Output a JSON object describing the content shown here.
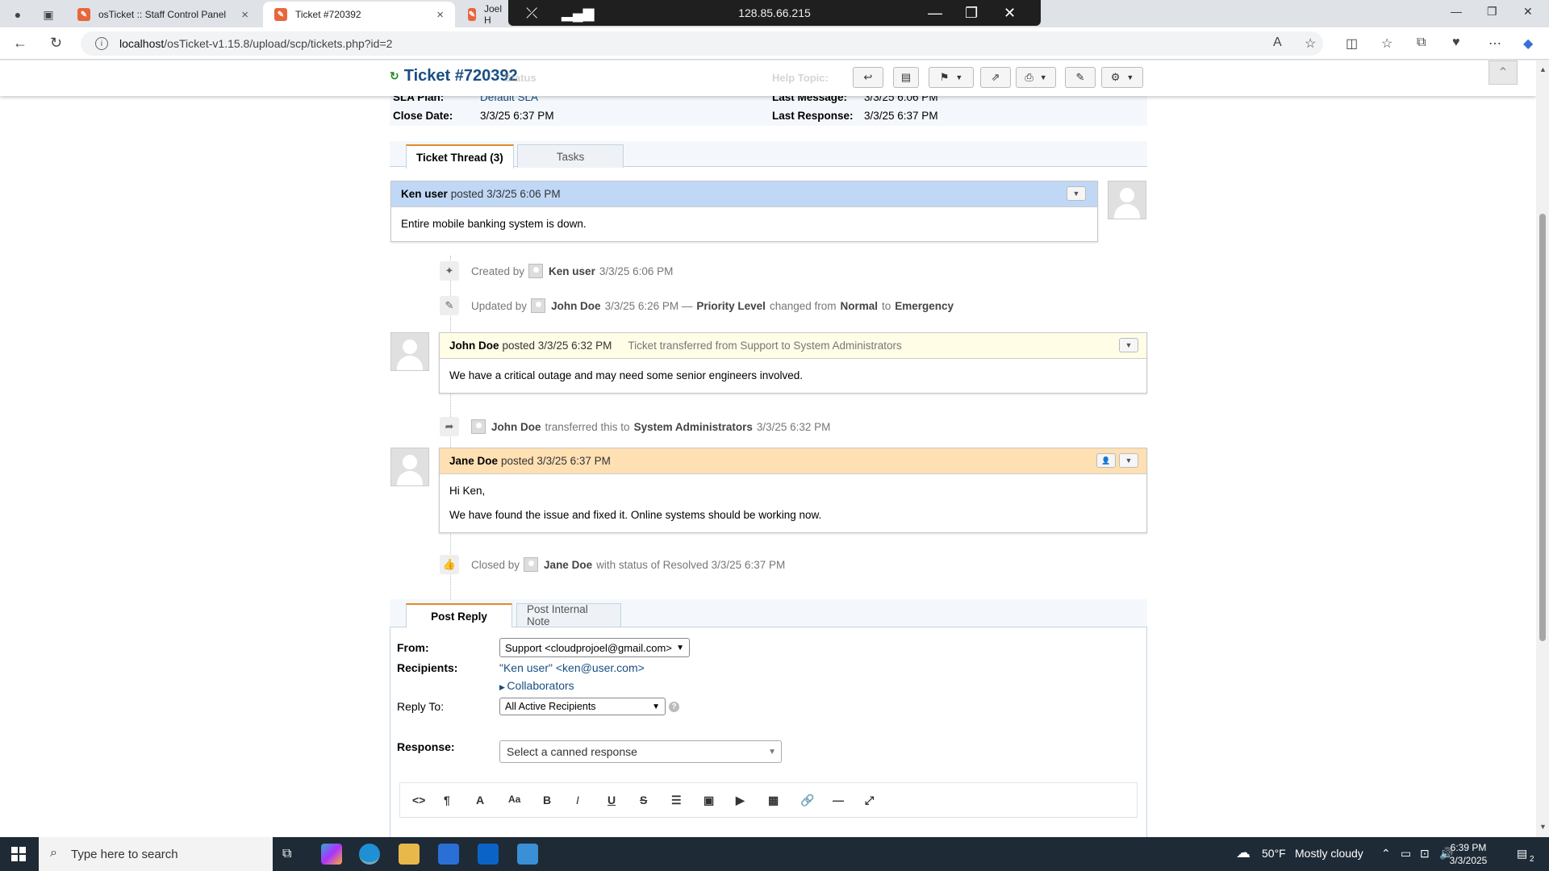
{
  "browser": {
    "tabs": [
      {
        "label": "osTicket :: Staff Control Panel",
        "active": false
      },
      {
        "label": "Ticket #720392",
        "active": true
      },
      {
        "label": "Joel H",
        "active": false
      }
    ],
    "remote_ip": "128.85.66.215",
    "url_host": "localhost",
    "url_path": "/osTicket-v1.15.8/upload/scp/tickets.php?id=2"
  },
  "ticket": {
    "title": "Ticket #720392",
    "ghost_left": "Status",
    "ghost_help": "Help Topic:",
    "info": {
      "sla_label": "SLA Plan:",
      "sla_value": "Default SLA",
      "last_message_label": "Last Message:",
      "last_message_value": "3/3/25 6:06 PM",
      "close_date_label": "Close Date:",
      "close_date_value": "3/3/25 6:37 PM",
      "last_response_label": "Last Response:",
      "last_response_value": "3/3/25 6:37 PM"
    }
  },
  "thread_tabs": {
    "thread": "Ticket Thread (3)",
    "tasks": "Tasks"
  },
  "thread": {
    "entry1": {
      "author": "Ken user",
      "posted": "posted 3/3/25 6:06 PM",
      "body": "Entire mobile banking system is down."
    },
    "event_created": {
      "pre": "Created by",
      "who": "Ken user",
      "when": "3/3/25 6:06 PM"
    },
    "event_updated": {
      "pre": "Updated by",
      "who": "John Doe",
      "when": "3/3/25 6:26 PM —",
      "field": "Priority Level",
      "mid": "changed from",
      "from": "Normal",
      "to_word": "to",
      "to": "Emergency"
    },
    "entry2": {
      "author": "John Doe",
      "posted": "posted 3/3/25 6:32 PM",
      "title": "Ticket transferred from Support to System Administrators",
      "body": "We have a critical outage and may need some senior engineers involved."
    },
    "event_transfer": {
      "who": "John Doe",
      "mid": "transferred this to",
      "dept": "System Administrators",
      "when": "3/3/25 6:32 PM"
    },
    "entry3": {
      "author": "Jane Doe",
      "posted": "posted 3/3/25 6:37 PM",
      "body1": "Hi Ken,",
      "body2": "We have found the issue and fixed it. Online systems should be working now."
    },
    "event_closed": {
      "pre": "Closed by",
      "who": "Jane Doe",
      "post": "with status of Resolved 3/3/25 6:37 PM"
    }
  },
  "reply": {
    "tab_reply": "Post Reply",
    "tab_note": "Post Internal Note",
    "from_label": "From:",
    "from_value": "Support <cloudprojoel@gmail.com>",
    "recipients_label": "Recipients:",
    "recipients_value": "\"Ken user\" <ken@user.com>",
    "collaborators": "Collaborators",
    "reply_to_label": "Reply To:",
    "reply_to_value": "All Active Recipients",
    "response_label": "Response:",
    "response_placeholder": "Select a canned response"
  },
  "taskbar": {
    "search_placeholder": "Type here to search",
    "weather_temp": "50°F",
    "weather_text": "Mostly cloudy",
    "time": "6:39 PM",
    "date": "3/3/2025",
    "notif_count": "2"
  },
  "colors": {
    "accent": "#184e81",
    "user_head": "#c0d8f6",
    "staff_head": "#fffde6",
    "response_head": "#ffe0b3"
  }
}
